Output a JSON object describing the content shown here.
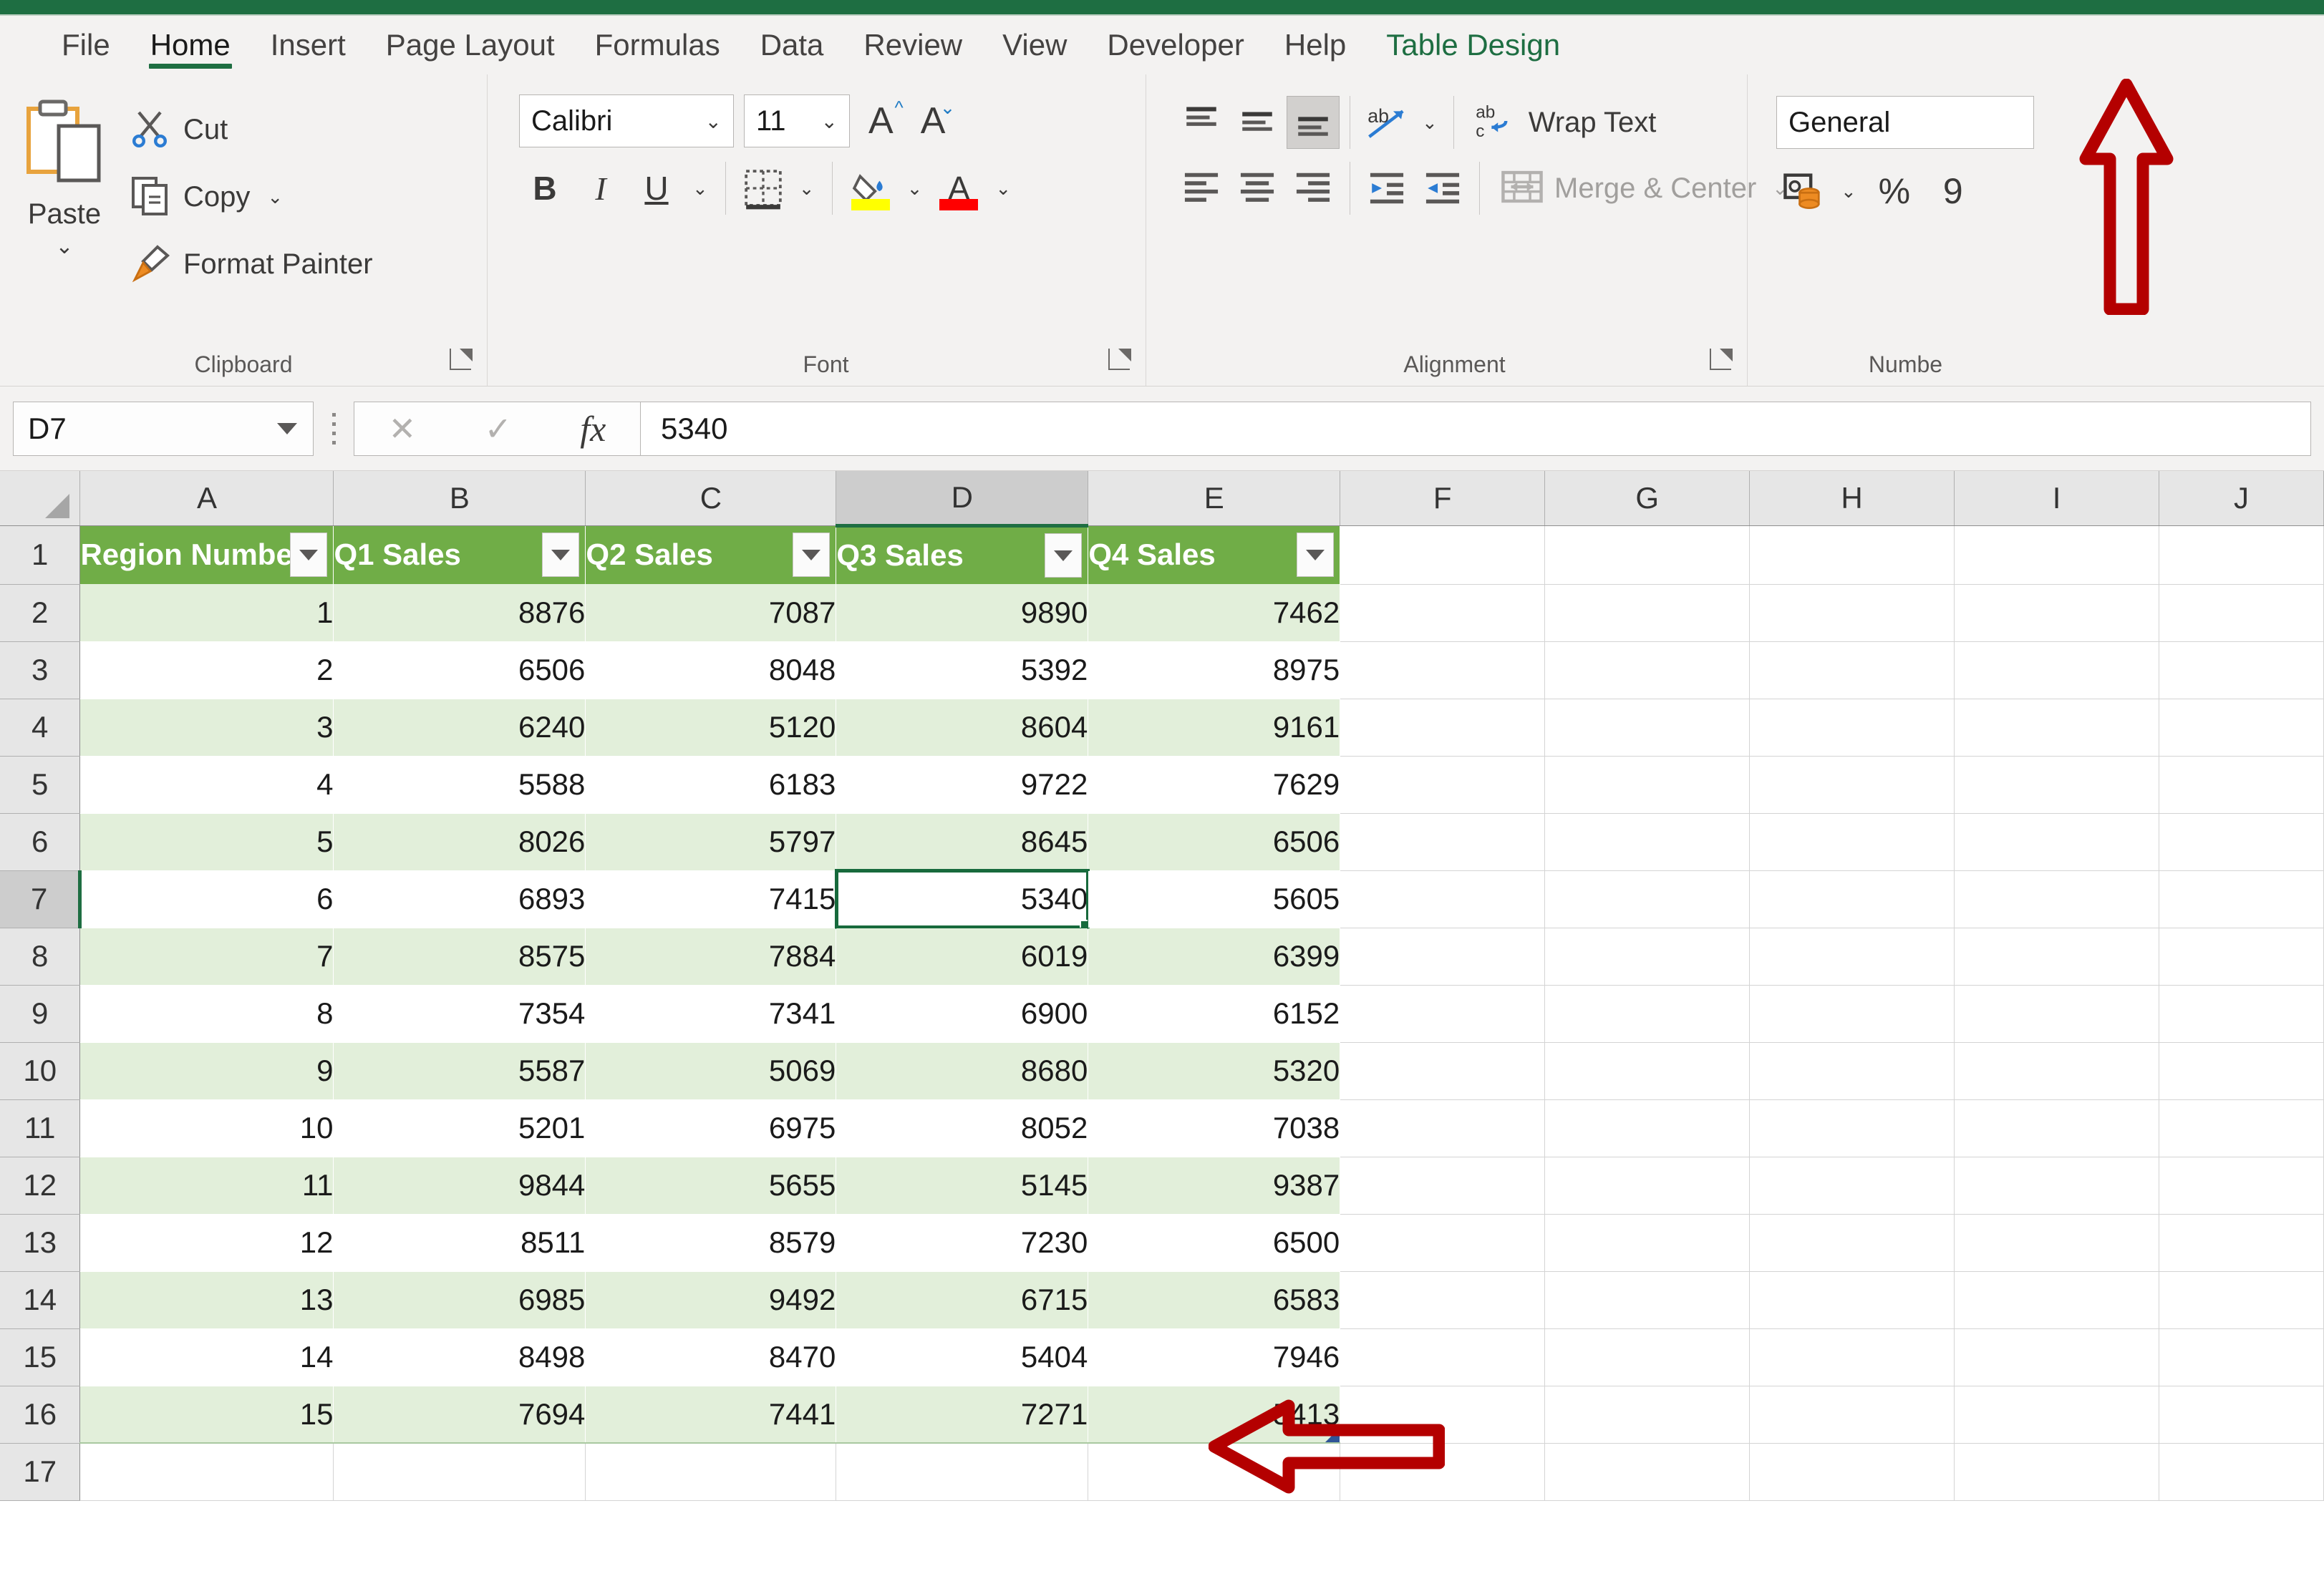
{
  "app": {
    "accent_green": "#1e6e42",
    "table_header_green": "#70ad47",
    "band_green": "#e2efda",
    "annotation_red": "#b40000"
  },
  "ribbon": {
    "tabs": [
      {
        "label": "File",
        "active": false,
        "contextual": false
      },
      {
        "label": "Home",
        "active": true,
        "contextual": false
      },
      {
        "label": "Insert",
        "active": false,
        "contextual": false
      },
      {
        "label": "Page Layout",
        "active": false,
        "contextual": false
      },
      {
        "label": "Formulas",
        "active": false,
        "contextual": false
      },
      {
        "label": "Data",
        "active": false,
        "contextual": false
      },
      {
        "label": "Review",
        "active": false,
        "contextual": false
      },
      {
        "label": "View",
        "active": false,
        "contextual": false
      },
      {
        "label": "Developer",
        "active": false,
        "contextual": false
      },
      {
        "label": "Help",
        "active": false,
        "contextual": false
      },
      {
        "label": "Table Design",
        "active": false,
        "contextual": true
      }
    ],
    "clipboard": {
      "group_label": "Clipboard",
      "paste_label": "Paste",
      "cut_label": "Cut",
      "copy_label": "Copy",
      "format_painter_label": "Format Painter"
    },
    "font": {
      "group_label": "Font",
      "font_name": "Calibri",
      "font_size": "11",
      "bold_label": "B",
      "italic_label": "I",
      "underline_label": "U",
      "highlight_color": "#ffff00",
      "font_color": "#ff0000"
    },
    "alignment": {
      "group_label": "Alignment",
      "wrap_text_label": "Wrap Text",
      "merge_center_label": "Merge & Center"
    },
    "number": {
      "group_label": "Numbe",
      "format_value": "General",
      "percent_label": "%"
    }
  },
  "formula_bar": {
    "name_box_value": "D7",
    "cancel_icon": "cancel-icon",
    "enter_icon": "confirm-icon",
    "function_icon": "fx",
    "formula_value": "5340"
  },
  "grid": {
    "column_headers": [
      "A",
      "B",
      "C",
      "D",
      "E",
      "F",
      "G",
      "H",
      "I",
      "J"
    ],
    "selected_column": "D",
    "selected_row": 7,
    "row_numbers": [
      1,
      2,
      3,
      4,
      5,
      6,
      7,
      8,
      9,
      10,
      11,
      12,
      13,
      14,
      15,
      16,
      17
    ],
    "active_cell": "D7"
  },
  "table": {
    "headers": [
      "Region Number",
      "Q1 Sales",
      "Q2 Sales",
      "Q3 Sales",
      "Q4 Sales"
    ],
    "rows": [
      [
        "1",
        "8876",
        "7087",
        "9890",
        "7462"
      ],
      [
        "2",
        "6506",
        "8048",
        "5392",
        "8975"
      ],
      [
        "3",
        "6240",
        "5120",
        "8604",
        "9161"
      ],
      [
        "4",
        "5588",
        "6183",
        "9722",
        "7629"
      ],
      [
        "5",
        "8026",
        "5797",
        "8645",
        "6506"
      ],
      [
        "6",
        "6893",
        "7415",
        "5340",
        "5605"
      ],
      [
        "7",
        "8575",
        "7884",
        "6019",
        "6399"
      ],
      [
        "8",
        "7354",
        "7341",
        "6900",
        "6152"
      ],
      [
        "9",
        "5587",
        "5069",
        "8680",
        "5320"
      ],
      [
        "10",
        "5201",
        "6975",
        "8052",
        "7038"
      ],
      [
        "11",
        "9844",
        "5655",
        "5145",
        "9387"
      ],
      [
        "12",
        "8511",
        "8579",
        "7230",
        "6500"
      ],
      [
        "13",
        "6985",
        "9492",
        "6715",
        "6583"
      ],
      [
        "14",
        "8498",
        "8470",
        "5404",
        "7946"
      ],
      [
        "15",
        "7694",
        "7441",
        "7271",
        "5413"
      ]
    ]
  },
  "annotations": [
    {
      "name": "arrow-up-table-design",
      "direction": "up"
    },
    {
      "name": "arrow-left-active-cell",
      "direction": "left"
    }
  ]
}
